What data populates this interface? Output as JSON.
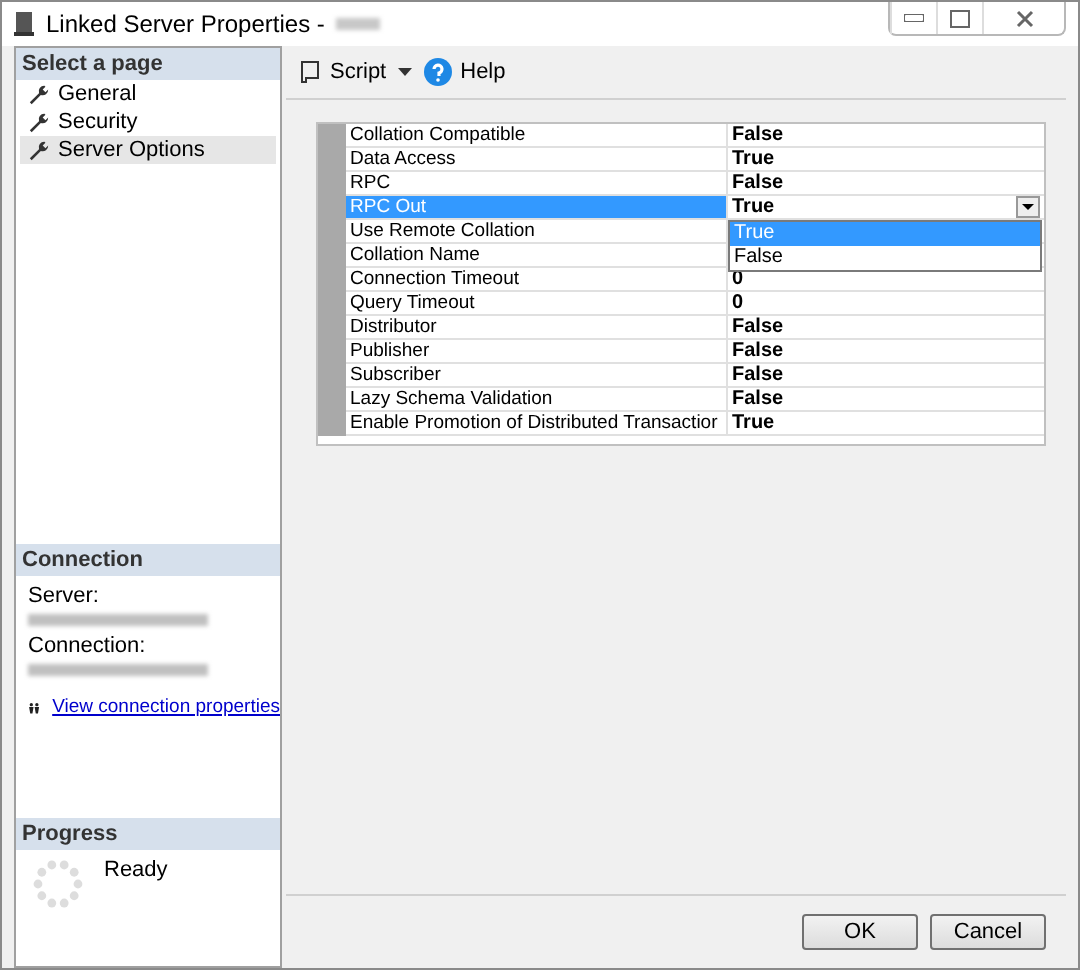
{
  "window": {
    "title": "Linked Server Properties -"
  },
  "sidebar": {
    "header": "Select a page",
    "items": [
      {
        "label": "General",
        "selected": false
      },
      {
        "label": "Security",
        "selected": false
      },
      {
        "label": "Server Options",
        "selected": true
      }
    ]
  },
  "connection": {
    "header": "Connection",
    "server_label": "Server:",
    "connection_label": "Connection:",
    "link": "View connection properties"
  },
  "progress": {
    "header": "Progress",
    "status": "Ready"
  },
  "toolbar": {
    "script": "Script",
    "help": "Help"
  },
  "grid": {
    "rows": [
      {
        "name": "Collation Compatible",
        "value": "False",
        "selected": false
      },
      {
        "name": "Data Access",
        "value": "True",
        "selected": false
      },
      {
        "name": "RPC",
        "value": "False",
        "selected": false
      },
      {
        "name": "RPC Out",
        "value": "True",
        "selected": true
      },
      {
        "name": "Use Remote Collation",
        "selected": false
      },
      {
        "name": "Collation Name",
        "selected": false
      },
      {
        "name": "Connection Timeout",
        "value": "0",
        "selected": false
      },
      {
        "name": "Query Timeout",
        "value": "0",
        "selected": false
      },
      {
        "name": "Distributor",
        "value": "False",
        "selected": false
      },
      {
        "name": "Publisher",
        "value": "False",
        "selected": false
      },
      {
        "name": "Subscriber",
        "value": "False",
        "selected": false
      },
      {
        "name": "Lazy Schema Validation",
        "value": "False",
        "selected": false
      },
      {
        "name": "Enable Promotion of Distributed Transactior",
        "value": "True",
        "selected": false
      }
    ],
    "dropdown": {
      "options": [
        {
          "label": "True",
          "selected": true
        },
        {
          "label": "False",
          "selected": false
        }
      ]
    }
  },
  "buttons": [
    "OK",
    "Cancel"
  ]
}
